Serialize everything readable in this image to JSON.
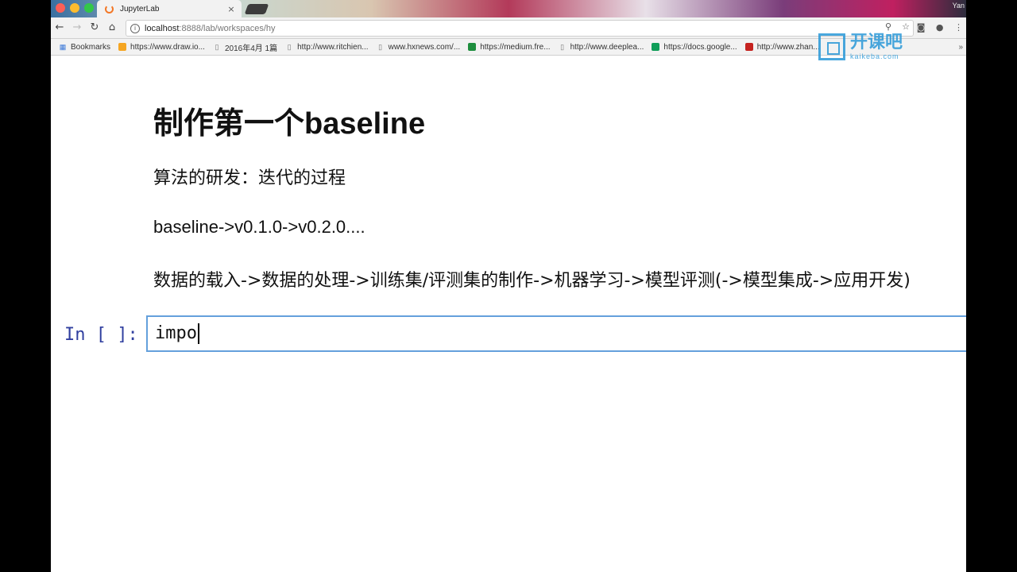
{
  "browser": {
    "tab": {
      "title": "JupyterLab",
      "close": "×"
    },
    "user": "Yan",
    "address": {
      "host": "localhost",
      "rest": ":8888/lab/workspaces/hy"
    },
    "bookmarks": [
      {
        "label": "Bookmarks",
        "icon": "apps-icon"
      },
      {
        "label": "https://www.draw.io...",
        "icon": "draw-icon"
      },
      {
        "label": "2016年4月 1篇",
        "icon": "page-icon"
      },
      {
        "label": "http://www.ritchien...",
        "icon": "page-icon"
      },
      {
        "label": "www.hxnews.com/...",
        "icon": "page-icon"
      },
      {
        "label": "https://medium.fre...",
        "icon": "green-icon"
      },
      {
        "label": "http://www.deeplea...",
        "icon": "page-icon"
      },
      {
        "label": "https://docs.google...",
        "icon": "sheet-icon"
      },
      {
        "label": "http://www.zhan...",
        "icon": "red-icon"
      }
    ],
    "bookmarks_more": "»"
  },
  "watermark": {
    "cn": "开课吧",
    "en": "kaikeba.com"
  },
  "notebook": {
    "heading": "制作第一个baseline",
    "para1": "算法的研发：迭代的过程",
    "para2": "baseline->v0.1.0->v0.2.0....",
    "para3": "数据的载入->数据的处理->训练集/评测集的制作->机器学习->模型评测(->模型集成->应用开发)",
    "prompt": "In [ ]:",
    "code": "impo"
  },
  "colors": {
    "prompt": "#303f9f",
    "cell_border": "#64a0dc",
    "watermark": "#2a98d8"
  }
}
